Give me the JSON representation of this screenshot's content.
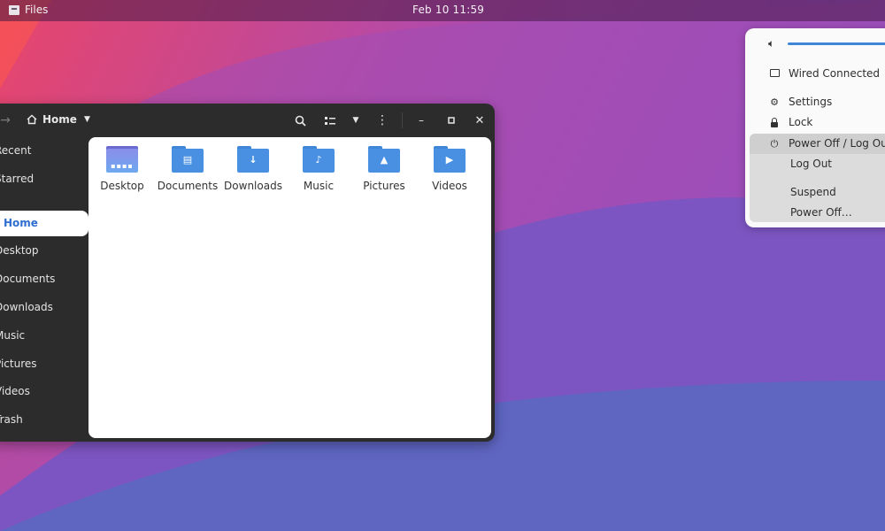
{
  "topbar": {
    "app_name": "Files",
    "clock": "Feb 10  11:59"
  },
  "window": {
    "path_label": "Home",
    "icons": [
      "forward-arrow-icon",
      "home-icon",
      "search-icon",
      "view-list-icon",
      "chevron-down-icon",
      "kebab-menu-icon",
      "minimize-icon",
      "maximize-icon",
      "close-icon"
    ]
  },
  "sidebar": {
    "items": [
      {
        "label": "Recent"
      },
      {
        "label": "Starred"
      },
      {
        "label": "Home"
      },
      {
        "label": "Desktop"
      },
      {
        "label": "Documents"
      },
      {
        "label": "Downloads"
      },
      {
        "label": "Music"
      },
      {
        "label": "Pictures"
      },
      {
        "label": "Videos"
      },
      {
        "label": "Trash"
      }
    ],
    "active": "Home"
  },
  "files": [
    {
      "name": "Desktop",
      "icon": "desktop-folder-icon"
    },
    {
      "name": "Documents",
      "icon": "documents-folder-icon"
    },
    {
      "name": "Downloads",
      "icon": "downloads-folder-icon"
    },
    {
      "name": "Music",
      "icon": "music-folder-icon"
    },
    {
      "name": "Pictures",
      "icon": "pictures-folder-icon"
    },
    {
      "name": "Videos",
      "icon": "videos-folder-icon"
    }
  ],
  "system_menu": {
    "volume_level": 1.0,
    "wired": "Wired Connected",
    "settings": "Settings",
    "lock": "Lock",
    "power_header": "Power Off / Log Out",
    "log_out": "Log Out",
    "suspend": "Suspend",
    "power_off": "Power Off…"
  },
  "colors": {
    "accent": "#3f86d8",
    "folder": "#4a90e2",
    "window_bg": "#2c2c2c",
    "topbar_text": "#f4f0f4"
  }
}
